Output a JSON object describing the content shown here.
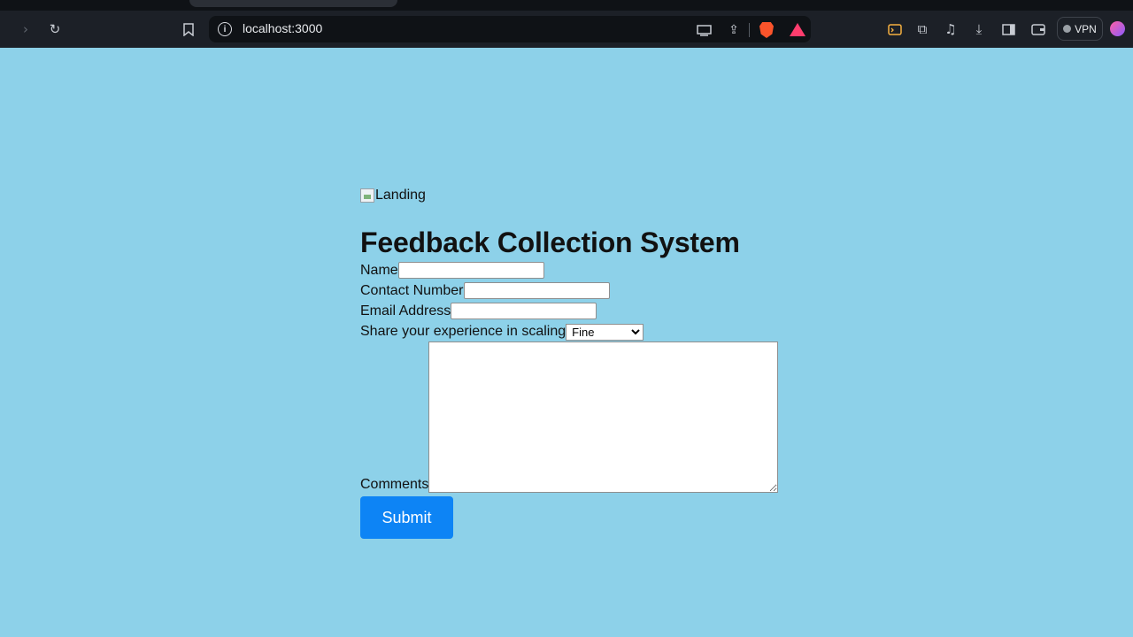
{
  "browser": {
    "url": "localhost:3000",
    "vpn_label": "VPN",
    "icons": [
      "forward-icon",
      "reload-icon",
      "bookmark-icon",
      "site-info-icon",
      "cast-icon",
      "share-icon",
      "brave-shields-icon",
      "brave-rewards-icon",
      "leo-icon",
      "extensions-icon",
      "media-icon",
      "downloads-icon",
      "sidebar-icon",
      "wallet-icon",
      "vpn-icon",
      "profile-icon"
    ]
  },
  "page": {
    "image_alt": "Landing",
    "title": "Feedback Collection System",
    "fields": {
      "name_label": "Name",
      "contact_label": "Contact Number",
      "email_label": "Email Address",
      "experience_label": "Share your experience in scaling",
      "experience_selected": "Fine",
      "comments_label": "Comments"
    },
    "submit_label": "Submit"
  },
  "colors": {
    "page_background": "#8dd1e9",
    "submit_button": "#0d84f5",
    "browser_toolbar": "#1c2027"
  }
}
